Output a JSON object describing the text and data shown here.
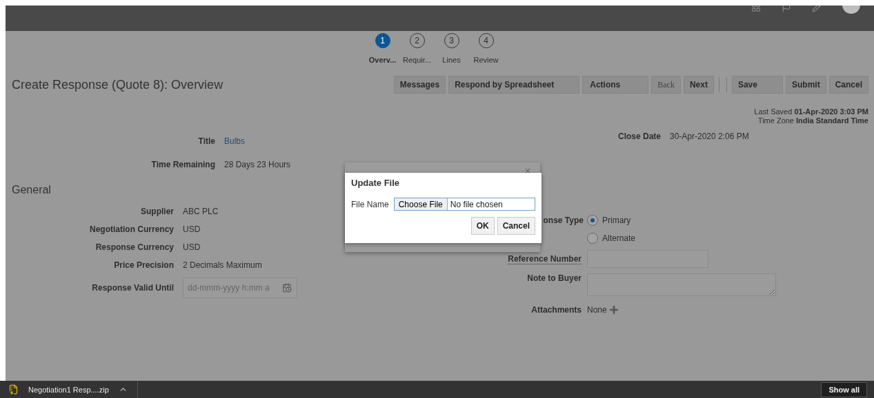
{
  "train": [
    {
      "number": "1",
      "label": "Overv...",
      "selected": true
    },
    {
      "number": "2",
      "label": "Requir...",
      "selected": false
    },
    {
      "number": "3",
      "label": "Lines",
      "selected": false
    },
    {
      "number": "4",
      "label": "Review",
      "selected": false
    }
  ],
  "page_title": "Create Response (Quote 8): Overview",
  "toolbar": [
    {
      "label": "Messages",
      "kind": "button"
    },
    {
      "label": "Respond by Spreadsheet",
      "kind": "split"
    },
    {
      "label": "Actions",
      "kind": "wide"
    },
    {
      "label": "Back",
      "kind": "disabled"
    },
    {
      "label": "Next",
      "kind": "button"
    },
    {
      "label": "Save",
      "kind": "split"
    },
    {
      "label": "Submit",
      "kind": "button"
    },
    {
      "label": "Cancel",
      "kind": "button"
    }
  ],
  "last_saved": {
    "label": "Last Saved",
    "value": "01-Apr-2020 3:03 PM"
  },
  "time_zone": {
    "label": "Time Zone",
    "value": "India Standard Time"
  },
  "header_fields": [
    {
      "label": "Title",
      "value": "Bulbs",
      "kind": "link"
    },
    {
      "label": "Time Remaining",
      "value": "28 Days 23 Hours",
      "kind": "text"
    }
  ],
  "close_date": {
    "label": "Close Date",
    "value": "30-Apr-2020 2:06 PM"
  },
  "section": "General",
  "general_fields": [
    {
      "label": "Supplier",
      "value": "ABC PLC"
    },
    {
      "label": "Negotiation Currency",
      "value": "USD"
    },
    {
      "label": "Response Currency",
      "value": "USD"
    },
    {
      "label": "Price Precision",
      "value": "2 Decimals Maximum"
    }
  ],
  "valid_until": {
    "label": "Response Valid Until",
    "placeholder": "dd-mmm-yyyy h:mm a"
  },
  "response_type": {
    "label": "onse Type",
    "options": [
      {
        "label": "Primary",
        "selected": true
      },
      {
        "label": "Alternate",
        "selected": false
      }
    ]
  },
  "reference_number": {
    "label": "Reference Number"
  },
  "note_to_buyer": {
    "label": "Note to Buyer"
  },
  "attachments": {
    "label": "Attachments",
    "value": "None"
  },
  "update_dialog": {
    "title": "Update File",
    "field_label": "File Name",
    "choose": "Choose File",
    "status": "No file chosen",
    "buttons": [
      "OK",
      "Cancel"
    ]
  },
  "download_bar": {
    "file": "Negotiation1 Resp....zip",
    "show_all": "Show all"
  }
}
